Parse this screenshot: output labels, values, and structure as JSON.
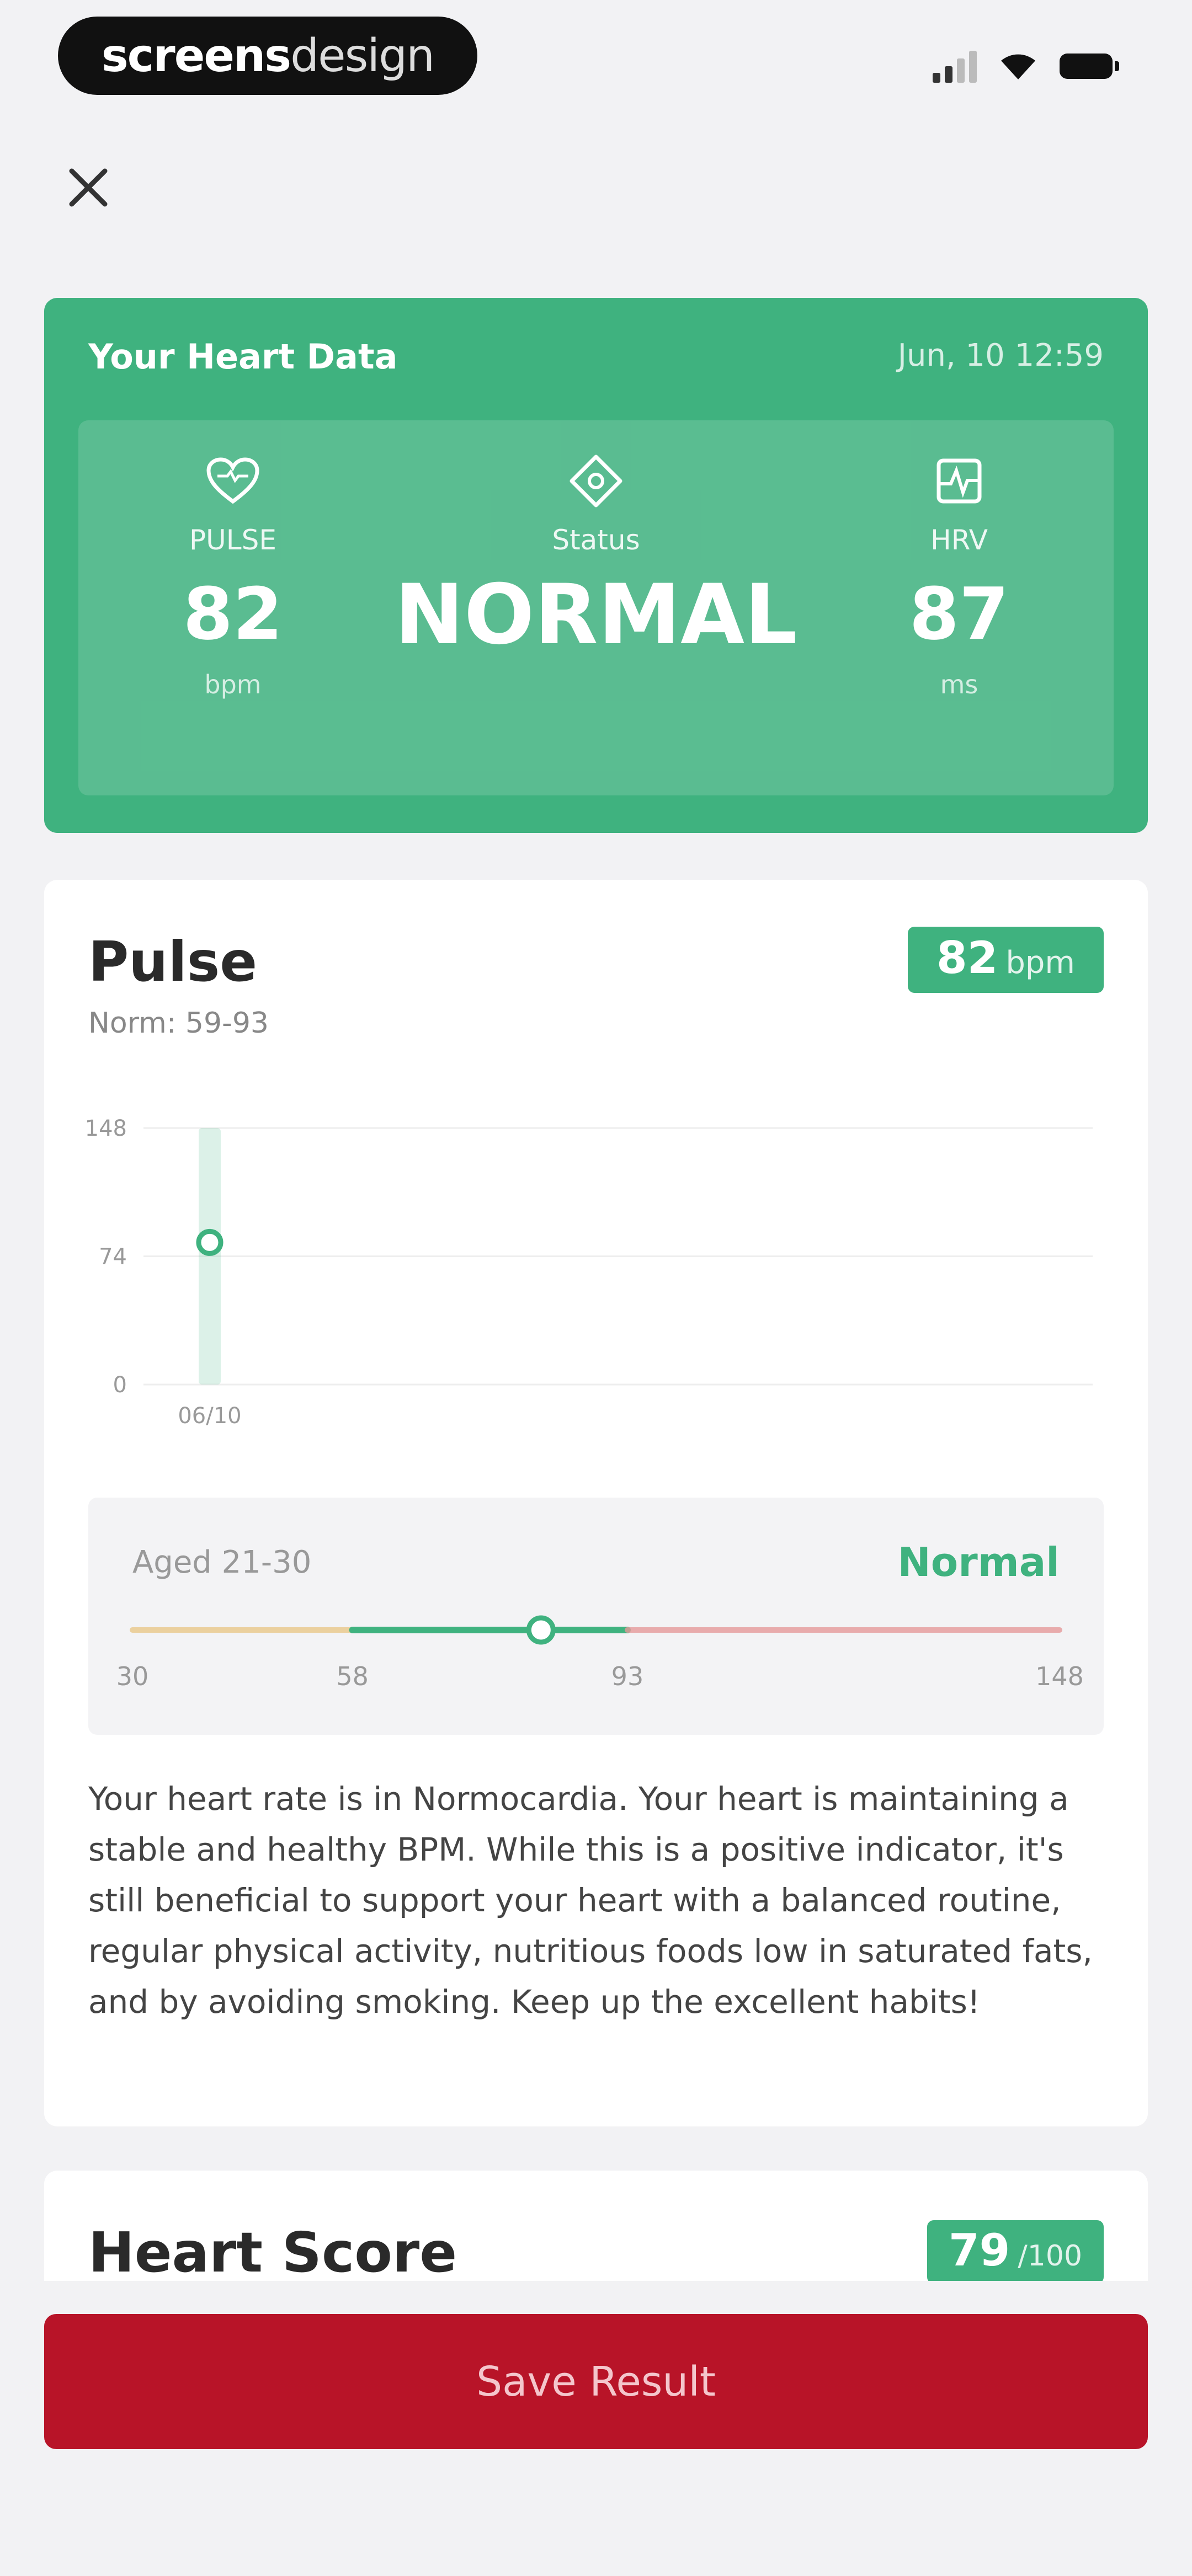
{
  "status_bar": {
    "brand_bold": "screens",
    "brand_light": "design"
  },
  "heart_data": {
    "title": "Your Heart Data",
    "date": "Jun, 10 12:59",
    "pulse": {
      "label": "PULSE",
      "value": "82",
      "unit": "bpm"
    },
    "status": {
      "label": "Status",
      "value": "NORMAL"
    },
    "hrv": {
      "label": "HRV",
      "value": "87",
      "unit": "ms"
    }
  },
  "pulse_section": {
    "title": "Pulse",
    "norm": "Norm: 59-93",
    "badge_value": "82",
    "badge_unit": "bpm",
    "chart_data": {
      "type": "scatter",
      "y_ticks": [
        "148",
        "74",
        "0"
      ],
      "x_ticks": [
        "06/10"
      ],
      "ylim": [
        0,
        148
      ],
      "points": [
        {
          "x": "06/10",
          "y": 82
        }
      ],
      "grid": true
    },
    "range": {
      "age_label": "Aged 21-30",
      "status": "Normal",
      "ticks": [
        "30",
        "58",
        "93",
        "148"
      ],
      "min": 30,
      "max": 148,
      "low": 58,
      "high": 93,
      "value": 82
    },
    "description": "Your heart rate is in Normocardia. Your heart is maintaining a stable and healthy BPM. While this is a positive indicator, it's still beneficial to support your heart with a balanced routine, regular physical activity, nutritious foods low in saturated fats, and by avoiding smoking. Keep up the excellent habits!"
  },
  "heart_score": {
    "title": "Heart Score",
    "badge_value": "79",
    "badge_unit": "/100"
  },
  "save_button": {
    "label": "Save Result"
  },
  "colors": {
    "accent": "#3fb27f",
    "danger": "#b81428",
    "warning": "#e8c27a",
    "high": "#e69a9a"
  }
}
